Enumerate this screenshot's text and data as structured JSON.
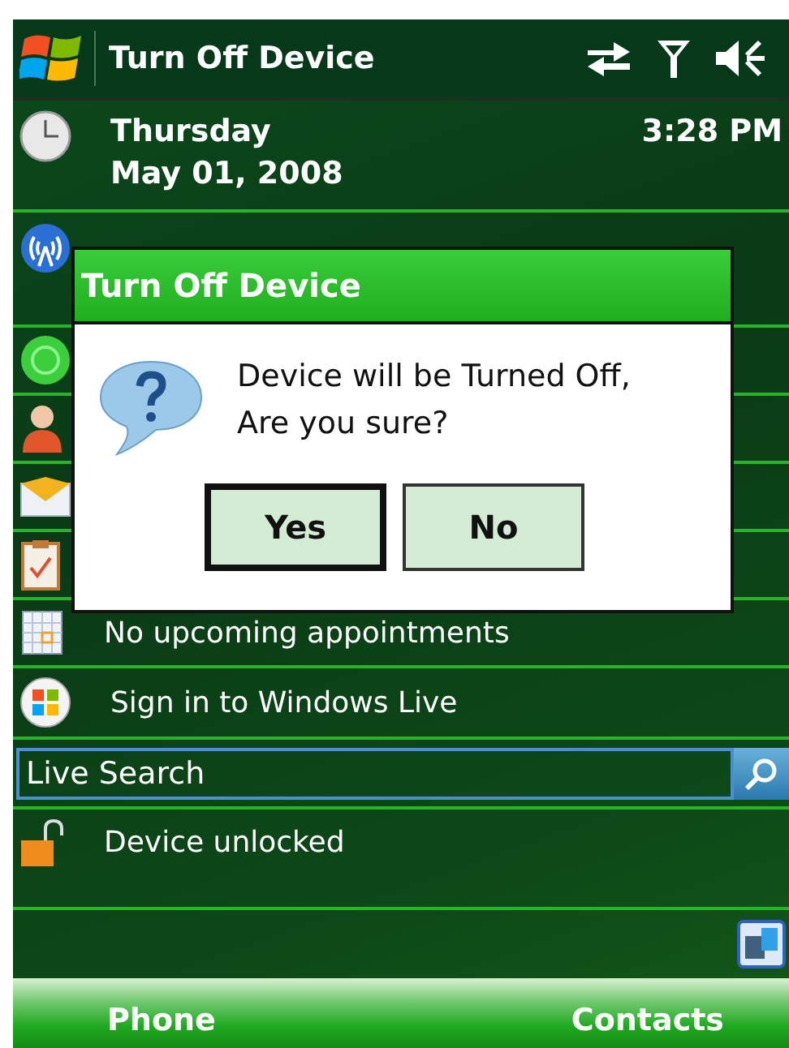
{
  "title_bar": {
    "title": "Turn Off Device"
  },
  "date_row": {
    "day": "Thursday",
    "date": "May 01, 2008",
    "time": "3:28 PM"
  },
  "appointments": {
    "text": "No upcoming appointments"
  },
  "windows_live": {
    "text": "Sign in to Windows Live"
  },
  "search": {
    "placeholder": "Live Search"
  },
  "lock": {
    "text": "Device unlocked"
  },
  "dialog": {
    "title": "Turn Off Device",
    "message": [
      "Device will be Turned Off,",
      "Are you sure?"
    ],
    "buttons": [
      {
        "label": "Yes",
        "selected": true
      },
      {
        "label": "No",
        "selected": false
      }
    ]
  },
  "soft_keys": [
    "Phone",
    "Contacts"
  ]
}
